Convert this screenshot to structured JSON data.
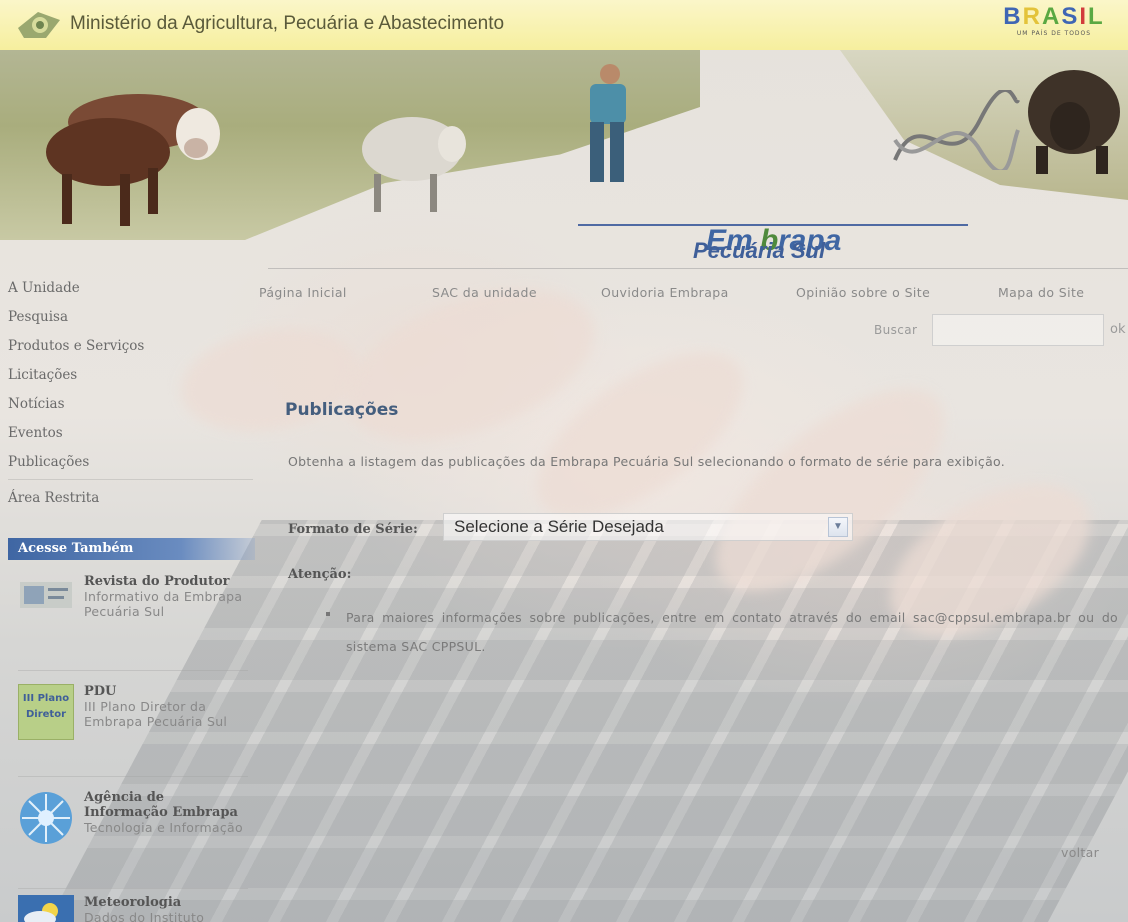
{
  "header": {
    "ministry": "Ministério da Agricultura, Pecuária e Abastecimento",
    "country_logo": "BRASIL",
    "country_slogan": "UM PAÍS DE TODOS",
    "org_logo": "Embrapa",
    "unit_name": "Pecuária Sul"
  },
  "left_nav": {
    "items": [
      {
        "label": "A Unidade"
      },
      {
        "label": "Pesquisa"
      },
      {
        "label": "Produtos e Serviços"
      },
      {
        "label": "Licitações"
      },
      {
        "label": "Notícias"
      },
      {
        "label": "Eventos"
      },
      {
        "label": "Publicações"
      },
      {
        "label": "Área Restrita"
      }
    ]
  },
  "also": {
    "header": "Acesse Também",
    "items": [
      {
        "title": "Revista do Produtor",
        "desc": "Informativo da Embrapa Pecuária Sul",
        "icon": "magazine-thumb"
      },
      {
        "title": "PDU",
        "desc": "III Plano Diretor da Embrapa Pecuária Sul",
        "icon": "plan-thumb",
        "thumb_text1": "III Plano",
        "thumb_text2": "Diretor"
      },
      {
        "title": "Agência de Informação Embrapa",
        "desc": "Tecnologia e Informação",
        "icon": "agency-thumb"
      },
      {
        "title": "Meteorologia",
        "desc": "Dados do Instituto",
        "icon": "weather-thumb"
      }
    ]
  },
  "top_menu": {
    "items": [
      {
        "label": "Página Inicial"
      },
      {
        "label": "SAC da unidade"
      },
      {
        "label": "Ouvidoria Embrapa"
      },
      {
        "label": "Opinião sobre o Site"
      },
      {
        "label": "Mapa do Site"
      }
    ]
  },
  "search": {
    "label": "Buscar",
    "value": "",
    "button": "ok"
  },
  "main": {
    "title": "Publicações",
    "intro": "Obtenha a listagem das publicações da Embrapa Pecuária Sul selecionando o formato de série para exibição.",
    "format_label": "Formato de Série:",
    "select_value": "Selecione a Série Desejada",
    "attention_label": "Atenção:",
    "note": "Para maiores informações sobre publicações, entre em contato através do email sac@cppsul.embrapa.br ou do sistema SAC CPPSUL.",
    "back_link": "voltar"
  },
  "colors": {
    "topbar": "#f6ef9e",
    "nav_header": "#3f66a3",
    "unit_name": "#3f5f99",
    "title": "#445e7e"
  }
}
